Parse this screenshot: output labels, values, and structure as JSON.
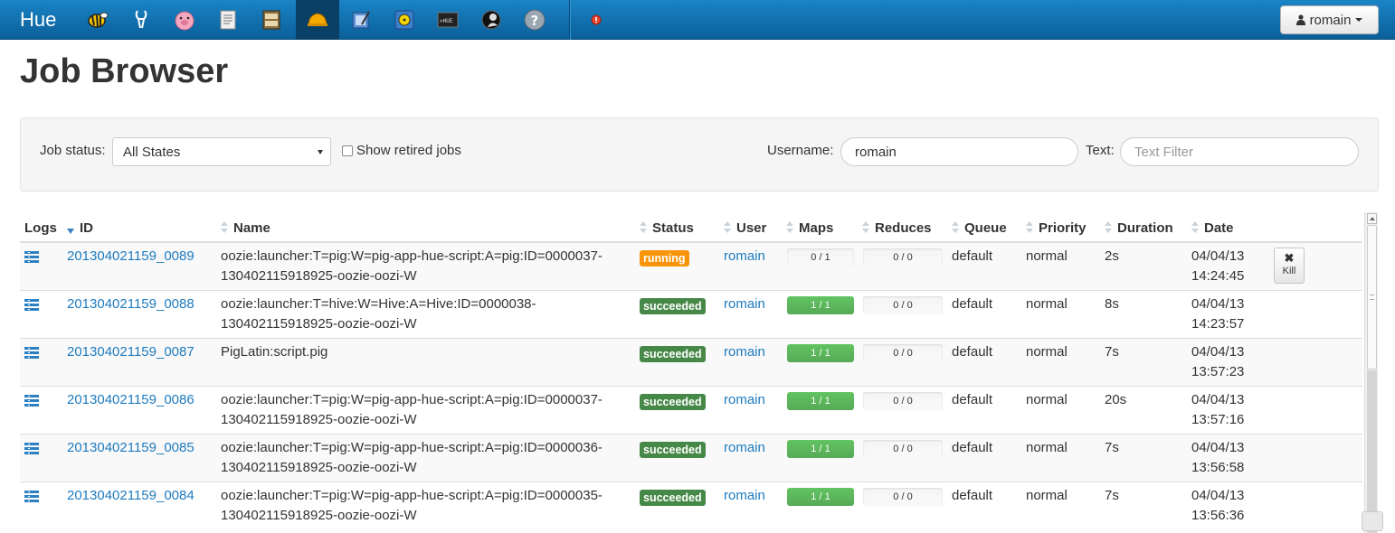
{
  "navbar": {
    "brand": "Hue",
    "apps": [
      {
        "name": "beeswax-icon",
        "color": "#f2c200"
      },
      {
        "name": "impala-icon",
        "color": "#ffffff"
      },
      {
        "name": "pig-icon",
        "color": "#f5a7c0"
      },
      {
        "name": "file-browser-icon",
        "color": "#f0f0f0"
      },
      {
        "name": "metastore-icon",
        "color": "#8b6d3e"
      },
      {
        "name": "job-browser-icon",
        "color": "#f2a900"
      },
      {
        "name": "job-designer-icon",
        "color": "#5a8fd6"
      },
      {
        "name": "oozie-icon",
        "color": "#f2d500"
      },
      {
        "name": "shell-icon",
        "color": "#222222"
      },
      {
        "name": "user-admin-icon",
        "color": "#111111"
      },
      {
        "name": "help-icon",
        "color": "#9aa6b2"
      }
    ],
    "alert_icon": "alert-icon",
    "user": "romain"
  },
  "page": {
    "title": "Job Browser"
  },
  "filters": {
    "job_status_label": "Job status:",
    "job_status_value": "All States",
    "show_retired_label": "Show retired jobs",
    "username_label": "Username:",
    "username_value": "romain",
    "text_label": "Text:",
    "text_placeholder": "Text Filter"
  },
  "table": {
    "columns": [
      "Logs",
      "ID",
      "Name",
      "Status",
      "User",
      "Maps",
      "Reduces",
      "Queue",
      "Priority",
      "Duration",
      "Date"
    ],
    "rows": [
      {
        "id": "201304021159_0089",
        "name1": "oozie:launcher:T=pig:W=pig-app-hue-script:A=pig:ID=0000037-",
        "name2": "130402115918925-oozie-oozi-W",
        "status": "running",
        "user": "romain",
        "maps": "0 / 1",
        "maps_done": false,
        "reduces": "0 / 0",
        "queue": "default",
        "priority": "normal",
        "duration": "2s",
        "date1": "04/04/13",
        "date2": "14:24:45",
        "kill": "Kill"
      },
      {
        "id": "201304021159_0088",
        "name1": "oozie:launcher:T=hive:W=Hive:A=Hive:ID=0000038-",
        "name2": "130402115918925-oozie-oozi-W",
        "status": "succeeded",
        "user": "romain",
        "maps": "1 / 1",
        "maps_done": true,
        "reduces": "0 / 0",
        "queue": "default",
        "priority": "normal",
        "duration": "8s",
        "date1": "04/04/13",
        "date2": "14:23:57"
      },
      {
        "id": "201304021159_0087",
        "name1": "PigLatin:script.pig",
        "name2": "",
        "status": "succeeded",
        "user": "romain",
        "maps": "1 / 1",
        "maps_done": true,
        "reduces": "0 / 0",
        "queue": "default",
        "priority": "normal",
        "duration": "7s",
        "date1": "04/04/13",
        "date2": "13:57:23"
      },
      {
        "id": "201304021159_0086",
        "name1": "oozie:launcher:T=pig:W=pig-app-hue-script:A=pig:ID=0000037-",
        "name2": "130402115918925-oozie-oozi-W",
        "status": "succeeded",
        "user": "romain",
        "maps": "1 / 1",
        "maps_done": true,
        "reduces": "0 / 0",
        "queue": "default",
        "priority": "normal",
        "duration": "20s",
        "date1": "04/04/13",
        "date2": "13:57:16"
      },
      {
        "id": "201304021159_0085",
        "name1": "oozie:launcher:T=pig:W=pig-app-hue-script:A=pig:ID=0000036-",
        "name2": "130402115918925-oozie-oozi-W",
        "status": "succeeded",
        "user": "romain",
        "maps": "1 / 1",
        "maps_done": true,
        "reduces": "0 / 0",
        "queue": "default",
        "priority": "normal",
        "duration": "7s",
        "date1": "04/04/13",
        "date2": "13:56:58"
      },
      {
        "id": "201304021159_0084",
        "name1": "oozie:launcher:T=pig:W=pig-app-hue-script:A=pig:ID=0000035-",
        "name2": "130402115918925-oozie-oozi-W",
        "status": "succeeded",
        "user": "romain",
        "maps": "1 / 1",
        "maps_done": true,
        "reduces": "0 / 0",
        "queue": "default",
        "priority": "normal",
        "duration": "7s",
        "date1": "04/04/13",
        "date2": "13:56:36"
      }
    ]
  }
}
